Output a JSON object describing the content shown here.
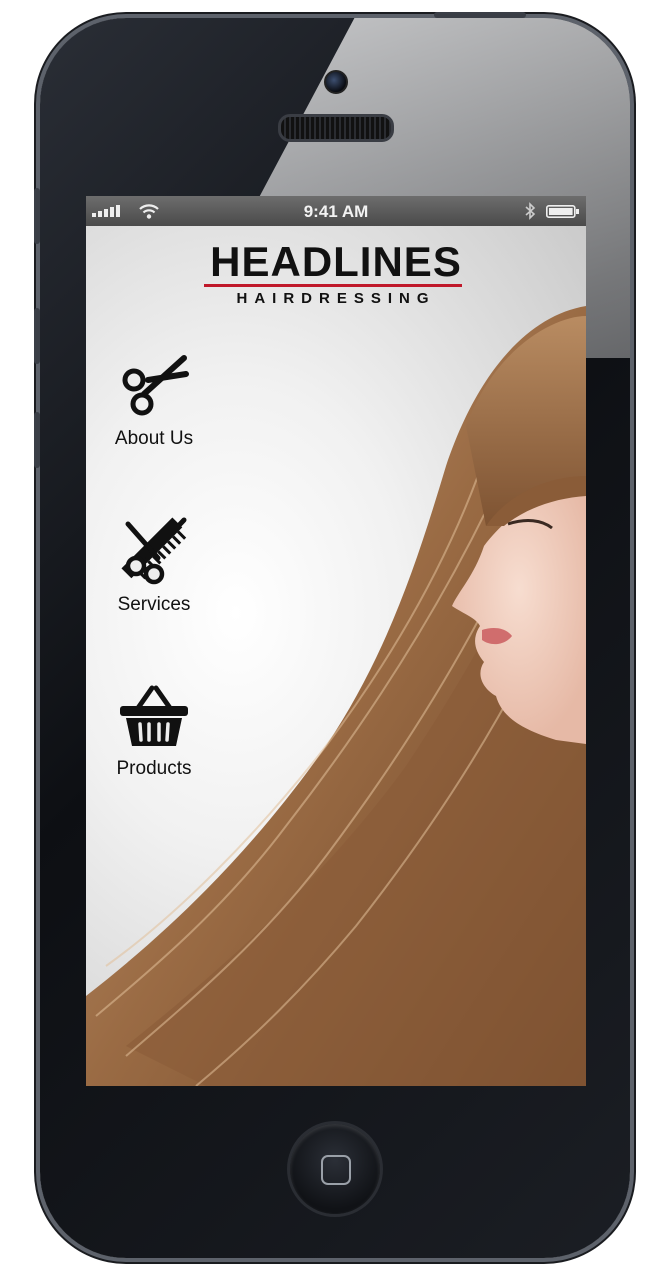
{
  "status_bar": {
    "time": "9:41 AM",
    "icons": [
      "signal-icon",
      "wifi-icon",
      "bluetooth-icon",
      "battery-icon"
    ]
  },
  "brand": {
    "title": "HEADLINES",
    "subtitle": "HAIRDRESSING",
    "accent_color": "#c0182a"
  },
  "menu": [
    {
      "label": "About Us",
      "icon": "scissors-icon"
    },
    {
      "label": "Services",
      "icon": "scissors-comb-icon"
    },
    {
      "label": "Products",
      "icon": "shopping-basket-icon"
    }
  ]
}
